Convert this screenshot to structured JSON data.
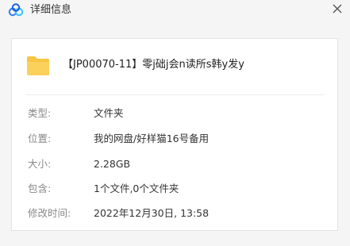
{
  "window": {
    "title": "详细信息"
  },
  "icons": {
    "app": "baidu-netdisk-cloud-icon",
    "close": "close-icon",
    "folder": "folder-icon"
  },
  "colors": {
    "folder": "#f8c544",
    "app_icon_blue": "#2f7cf6",
    "label": "#8a8a8a",
    "value": "#333333"
  },
  "file": {
    "name": "【JP00070-11】零j础j会n读所s韩y发y"
  },
  "details": {
    "type": {
      "label": "类型:",
      "value": "文件夹"
    },
    "location": {
      "label": "位置:",
      "value": "我的网盘/好样猫16号备用"
    },
    "size": {
      "label": "大小:",
      "value": "2.28GB"
    },
    "contains": {
      "label": "包含:",
      "value": "1个文件,0个文件夹"
    },
    "modified": {
      "label": "修改时间:",
      "value": "2022年12月30日, 13:58"
    }
  }
}
